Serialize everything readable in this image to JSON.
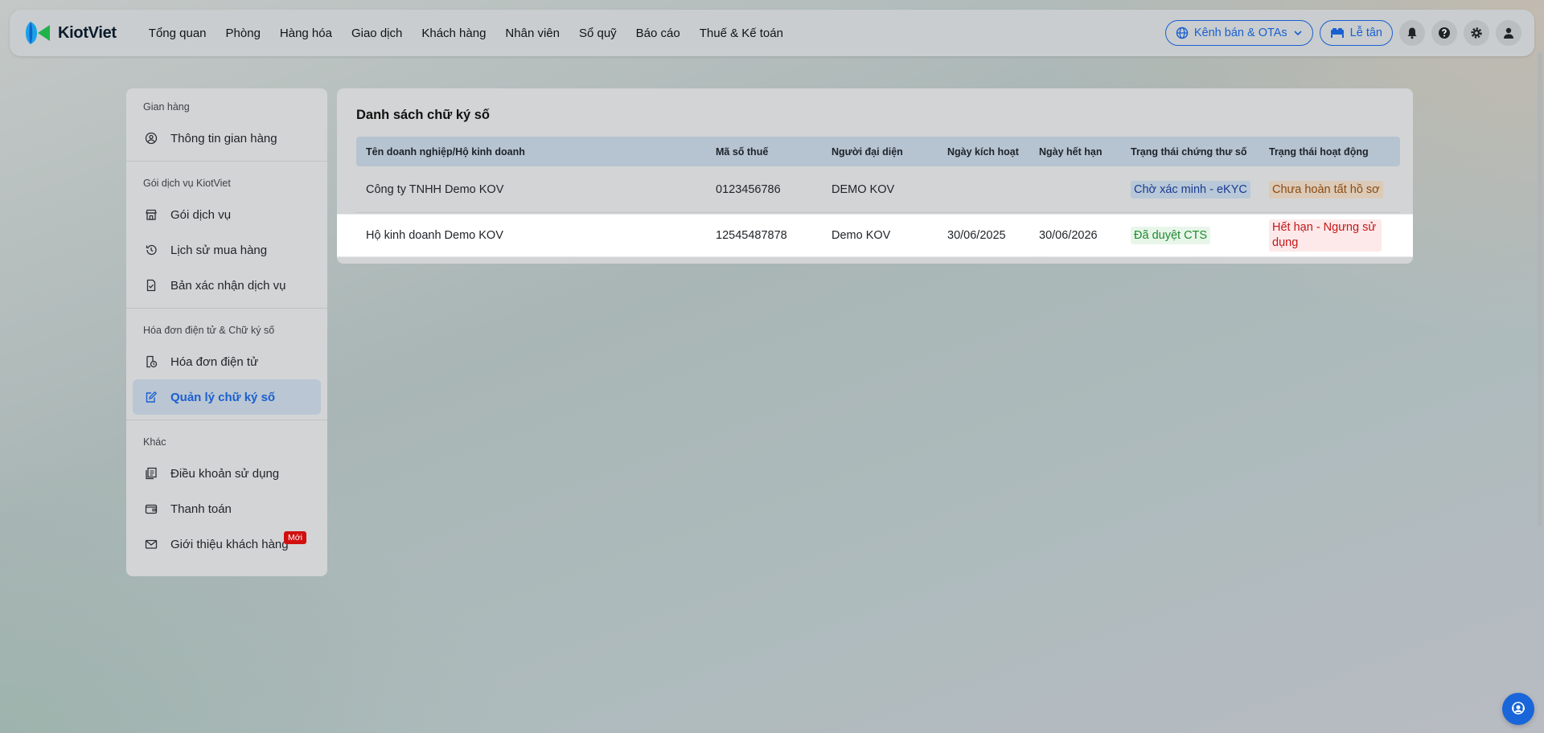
{
  "app": {
    "logo_text": "KiotViet"
  },
  "nav": {
    "items": [
      "Tổng quan",
      "Phòng",
      "Hàng hóa",
      "Giao dịch",
      "Khách hàng",
      "Nhân viên",
      "Sổ quỹ",
      "Báo cáo",
      "Thuế & Kế toán"
    ]
  },
  "header_right": {
    "channels_label": "Kênh bán & OTAs",
    "reception_label": "Lễ tân"
  },
  "sidebar": {
    "groups": [
      {
        "title": "Gian hàng",
        "items": [
          "Thông tin gian hàng"
        ]
      },
      {
        "title": "Gói dịch vụ KiotViet",
        "items": [
          "Gói dịch vụ",
          "Lịch sử mua hàng",
          "Bản xác nhận dịch vụ"
        ]
      },
      {
        "title": "Hóa đơn điện tử & Chữ ký số",
        "items": [
          "Hóa đơn điện tử",
          "Quản lý chữ ký số"
        ]
      },
      {
        "title": "Khác",
        "items": [
          "Điều khoản sử dụng",
          "Thanh toán",
          "Giới thiệu khách hàng"
        ]
      }
    ],
    "new_badge": "Mới"
  },
  "main": {
    "title": "Danh sách chữ ký số",
    "columns": [
      "Tên doanh nghiệp/Hộ kinh doanh",
      "Mã số thuế",
      "Người đại diện",
      "Ngày kích hoạt",
      "Ngày hết hạn",
      "Trạng thái chứng thư số",
      "Trạng thái hoạt động"
    ],
    "rows": [
      {
        "name": "Công ty TNHH Demo KOV",
        "tax_code": "0123456786",
        "representative": "DEMO KOV",
        "activated": "",
        "expires": "",
        "cert_status": "Chờ xác minh - eKYC",
        "activity_status": "Chưa hoàn tất hồ sơ"
      },
      {
        "name": "Hộ kinh doanh Demo KOV",
        "tax_code": "12545487878",
        "representative": "Demo KOV",
        "activated": "30/06/2025",
        "expires": "30/06/2026",
        "cert_status": "Đã duyệt CTS",
        "activity_status": "Hết hạn - Ngưng sử dụng"
      }
    ]
  },
  "colors": {
    "accent": "#1a5fd0",
    "badge_red": "#d10f0f",
    "fab": "#1866d9"
  }
}
